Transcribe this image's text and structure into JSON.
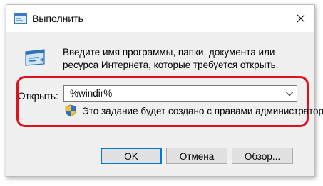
{
  "window": {
    "title": "Выполнить",
    "close_icon": "close-icon"
  },
  "dialog": {
    "description": "Введите имя программы, папки, документа или ресурса Интернета, которые требуется открыть.",
    "open_label": "Открыть:",
    "open_value": "%windir%",
    "admin_note": "Это задание будет создано с правами администратора",
    "highlight_color": "#e0101e"
  },
  "buttons": {
    "ok": "OK",
    "cancel": "Отмена",
    "browse": "Обзор..."
  },
  "icons": {
    "app": "run-icon",
    "shield": "uac-shield-icon",
    "dropdown": "chevron-down-icon"
  }
}
